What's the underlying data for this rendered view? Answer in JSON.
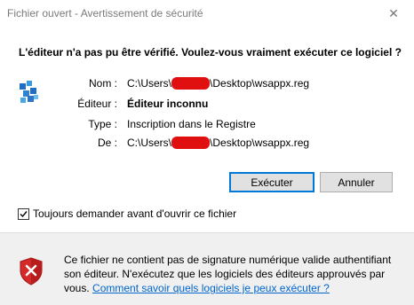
{
  "window": {
    "title": "Fichier ouvert - Avertissement de sécurité",
    "close_glyph": "✕"
  },
  "dialog": {
    "question": "L'éditeur n'a pas pu être vérifié. Voulez-vous vraiment exécuter ce logiciel ?",
    "fields": {
      "name_label": "Nom :",
      "name_prefix": "C:\\Users\\",
      "name_suffix": "\\Desktop\\wsappx.reg",
      "publisher_label": "Éditeur :",
      "publisher_value": "Éditeur inconnu",
      "type_label": "Type :",
      "type_value": "Inscription dans le Registre",
      "from_label": "De :",
      "from_prefix": "C:\\Users\\",
      "from_suffix": "\\Desktop\\wsappx.reg"
    },
    "buttons": {
      "run_label": "Exécuter",
      "cancel_label": "Annuler"
    },
    "always_ask": {
      "label": "Toujours demander avant d'ouvrir ce fichier",
      "checked": true
    },
    "footer": {
      "warning_text": "Ce fichier ne contient pas de signature numérique valide authentifiant son éditeur. N'exécutez que les logiciels des éditeurs approuvés par vous.",
      "link_text": "Comment savoir quels logiciels je peux exécuter ?"
    }
  },
  "icons": {
    "file": "registry-file-icon",
    "warning": "security-shield-error-icon",
    "redaction_color": "#e11010",
    "link_color": "#0066cc"
  }
}
